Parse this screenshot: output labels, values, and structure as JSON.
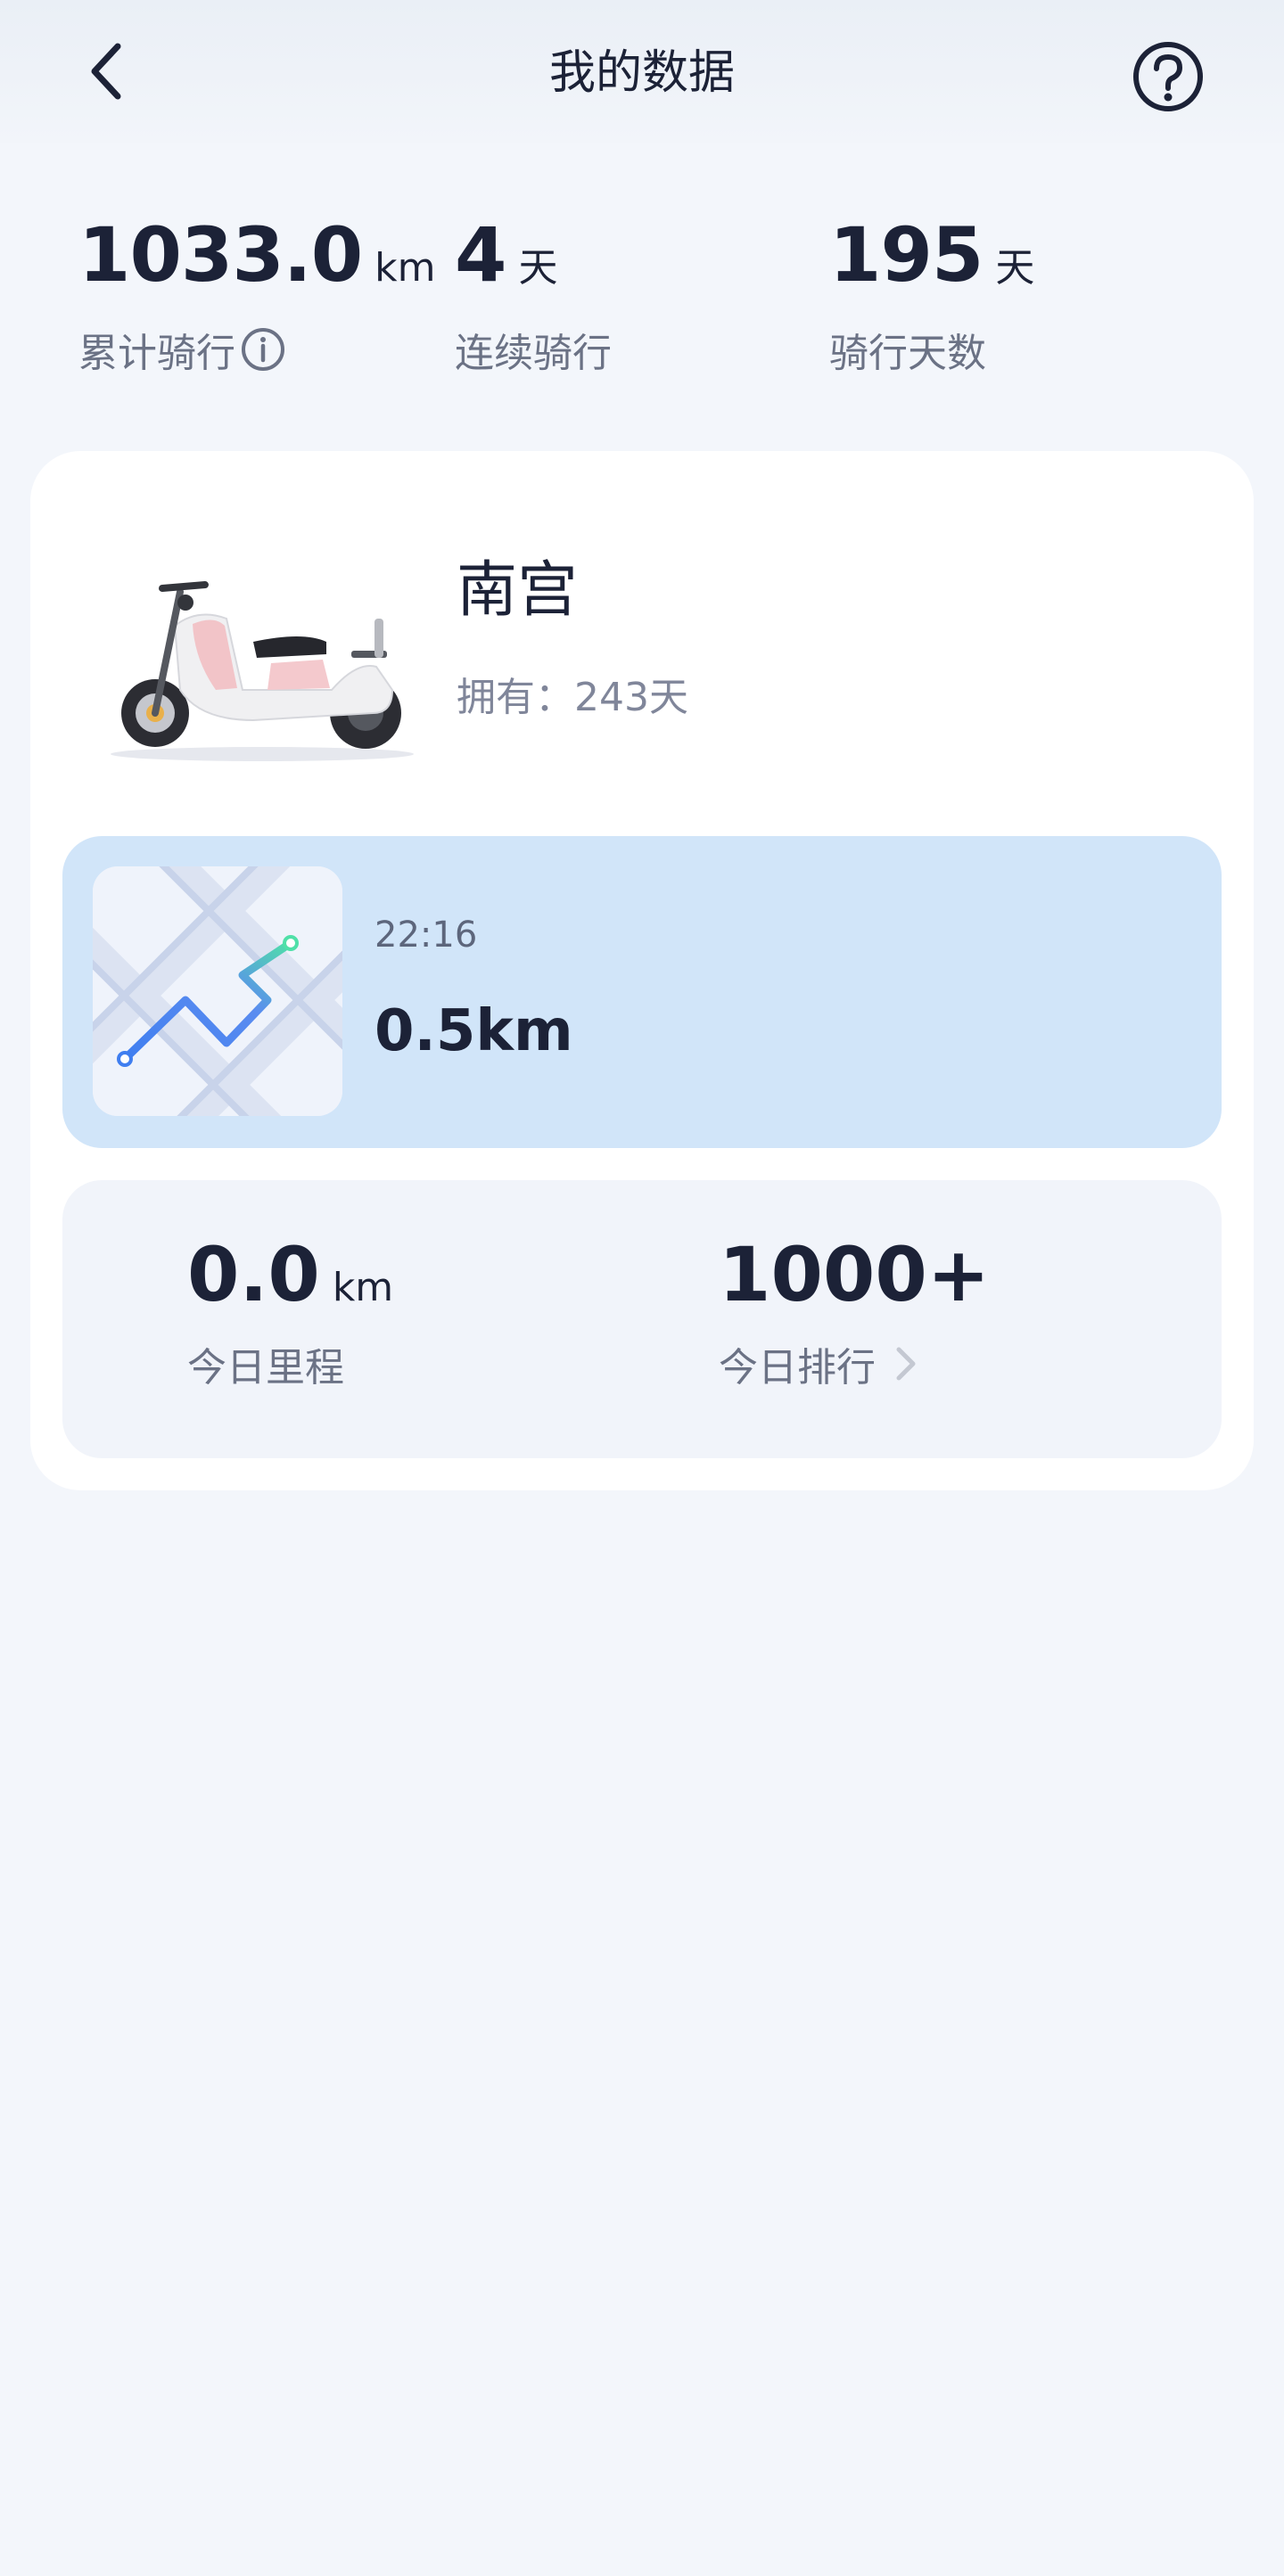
{
  "header": {
    "title": "我的数据"
  },
  "stats": {
    "total": {
      "value": "1033.0",
      "unit": "km",
      "label": "累计骑行"
    },
    "streak": {
      "value": "4",
      "unit": "天",
      "label": "连续骑行"
    },
    "days": {
      "value": "195",
      "unit": "天",
      "label": "骑行天数"
    }
  },
  "vehicle": {
    "name": "南宫",
    "owned": "拥有：243天"
  },
  "trip": {
    "time": "22:16",
    "distance": "0.5km"
  },
  "today": {
    "mileage": {
      "value": "0.0",
      "unit": "km",
      "label": "今日里程"
    },
    "rank": {
      "value": "1000+",
      "label": "今日排行"
    }
  },
  "icons": {
    "back": "chevron-left-icon",
    "help": "question-circle-icon",
    "info": "info-circle-icon",
    "rank_arrow": "chevron-right-icon"
  },
  "colors": {
    "background": "#f3f6fb",
    "trip_card": "#d1e5f9",
    "today_card": "#f1f4fa",
    "text_primary": "#1c2237",
    "text_secondary": "#6b7285"
  }
}
